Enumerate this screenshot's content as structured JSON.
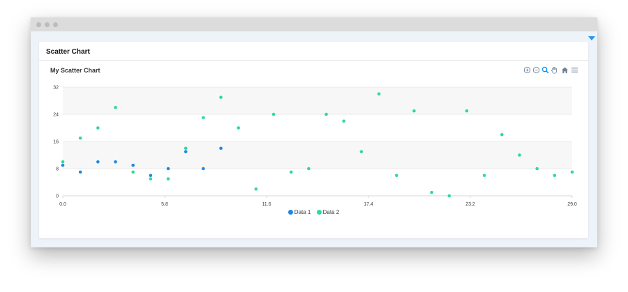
{
  "card": {
    "title": "Scatter Chart"
  },
  "toolbar": {
    "items": [
      {
        "name": "zoom-in-icon"
      },
      {
        "name": "zoom-out-icon"
      },
      {
        "name": "selection-zoom-icon"
      },
      {
        "name": "pan-icon"
      },
      {
        "name": "reset-zoom-icon"
      },
      {
        "name": "menu-icon"
      }
    ]
  },
  "colors": {
    "series1": "#1e88e5",
    "series2": "#2ed8a3",
    "accent": "#2196f3",
    "grid": "#e6e6e6",
    "band": "#f7f7f7"
  },
  "chart_data": {
    "type": "scatter",
    "title": "My Scatter Chart",
    "xlabel": "",
    "ylabel": "",
    "xlim": [
      0,
      29
    ],
    "ylim": [
      0,
      32
    ],
    "x_ticks": [
      "0.0",
      "5.8",
      "11.6",
      "17.4",
      "23.2",
      "29.0"
    ],
    "y_ticks": [
      "32",
      "24",
      "16",
      "8",
      "0"
    ],
    "grid": true,
    "legend_position": "bottom",
    "series": [
      {
        "name": "Data 1",
        "points": [
          [
            0,
            9
          ],
          [
            1,
            7
          ],
          [
            2,
            10
          ],
          [
            3,
            10
          ],
          [
            4,
            9
          ],
          [
            5,
            6
          ],
          [
            6,
            8
          ],
          [
            7,
            13
          ],
          [
            8,
            8
          ],
          [
            9,
            14
          ]
        ]
      },
      {
        "name": "Data 2",
        "points": [
          [
            0,
            10
          ],
          [
            1,
            17
          ],
          [
            2,
            20
          ],
          [
            3,
            26
          ],
          [
            4,
            7
          ],
          [
            5,
            5
          ],
          [
            6,
            5
          ],
          [
            7,
            14
          ],
          [
            8,
            23
          ],
          [
            9,
            29
          ],
          [
            10,
            20
          ],
          [
            11,
            2
          ],
          [
            12,
            24
          ],
          [
            13,
            7
          ],
          [
            14,
            8
          ],
          [
            15,
            24
          ],
          [
            16,
            22
          ],
          [
            17,
            13
          ],
          [
            18,
            30
          ],
          [
            19,
            6
          ],
          [
            20,
            25
          ],
          [
            21,
            1
          ],
          [
            22,
            0
          ],
          [
            23,
            25
          ],
          [
            24,
            6
          ],
          [
            25,
            18
          ],
          [
            26,
            12
          ],
          [
            27,
            8
          ],
          [
            28,
            6
          ],
          [
            29,
            7
          ]
        ]
      }
    ]
  }
}
